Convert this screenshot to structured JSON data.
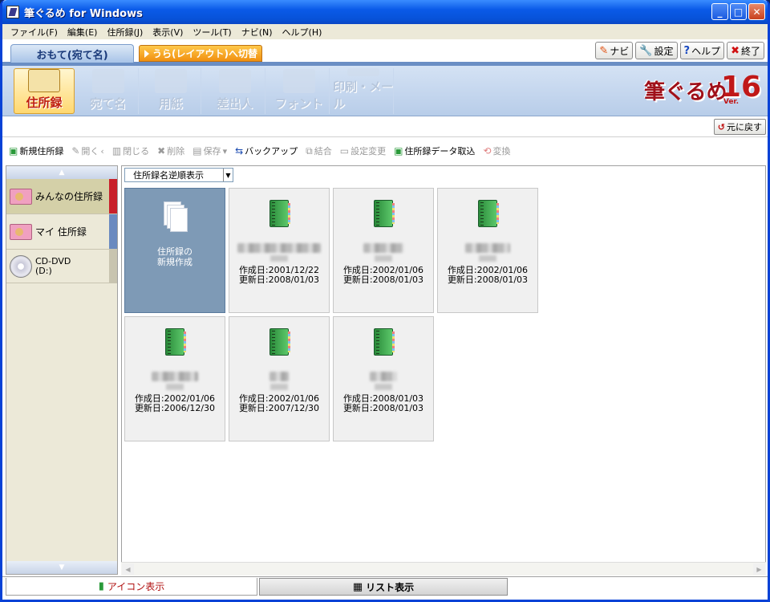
{
  "window": {
    "title": "筆ぐるめ for Windows"
  },
  "menubar": [
    "ファイル(F)",
    "編集(E)",
    "住所録(J)",
    "表示(V)",
    "ツール(T)",
    "ナビ(N)",
    "ヘルプ(H)"
  ],
  "tabs": {
    "front": "おもて(宛て名)",
    "back": "うら(レイアウト)へ切替"
  },
  "top_buttons": [
    {
      "label": "ナビ",
      "icon": "pen-icon"
    },
    {
      "label": "設定",
      "icon": "wrench-icon"
    },
    {
      "label": "ヘルプ",
      "icon": "question-icon"
    },
    {
      "label": "終了",
      "icon": "x-icon"
    }
  ],
  "big_tools": [
    "住所録",
    "宛て名",
    "用紙",
    "差出人",
    "フォント",
    "印刷・メール"
  ],
  "logo": {
    "text": "筆ぐるめ",
    "version": "16",
    "ver_label": "Ver."
  },
  "back_button": "元に戻す",
  "toolbar": [
    {
      "label": "新規住所録",
      "enabled": true,
      "icon": "new-book-icon"
    },
    {
      "label": "開く",
      "enabled": false,
      "icon": "open-icon"
    },
    {
      "label": "閉じる",
      "enabled": false,
      "icon": "close-book-icon"
    },
    {
      "label": "削除",
      "enabled": false,
      "icon": "delete-icon"
    },
    {
      "label": "保存",
      "enabled": false,
      "icon": "save-icon"
    },
    {
      "label": "バックアップ",
      "enabled": true,
      "icon": "backup-icon"
    },
    {
      "label": "結合",
      "enabled": false,
      "icon": "merge-icon"
    },
    {
      "label": "設定変更",
      "enabled": false,
      "icon": "settings-icon"
    },
    {
      "label": "住所録データ取込",
      "enabled": true,
      "icon": "import-icon"
    },
    {
      "label": "変換",
      "enabled": false,
      "icon": "convert-icon"
    }
  ],
  "sidebar": {
    "items": [
      {
        "label": "みんなの住所録",
        "selected": true,
        "bar_color": "#c8202a"
      },
      {
        "label": "マイ 住所録",
        "selected": false,
        "bar_color": "#6a8ac0"
      },
      {
        "label": "CD-DVD\n(D:)",
        "selected": false,
        "bar_color": "#c8c4b0"
      }
    ]
  },
  "sort_select": "住所録名逆順表示",
  "new_card_label": "住所録の\n新規作成",
  "books": [
    {
      "created": "作成日:2001/12/22",
      "updated": "更新日:2008/01/03",
      "blur_w": 104
    },
    {
      "created": "作成日:2002/01/06",
      "updated": "更新日:2008/01/03",
      "blur_w": 50
    },
    {
      "created": "作成日:2002/01/06",
      "updated": "更新日:2008/01/03",
      "blur_w": 56
    },
    {
      "created": "作成日:2002/01/06",
      "updated": "更新日:2006/12/30",
      "blur_w": 58
    },
    {
      "created": "作成日:2002/01/06",
      "updated": "更新日:2007/12/30",
      "blur_w": 24
    },
    {
      "created": "作成日:2008/01/03",
      "updated": "更新日:2008/01/03",
      "blur_w": 34
    }
  ],
  "view_buttons": {
    "icon_view": "アイコン表示",
    "list_view": "リスト表示"
  }
}
